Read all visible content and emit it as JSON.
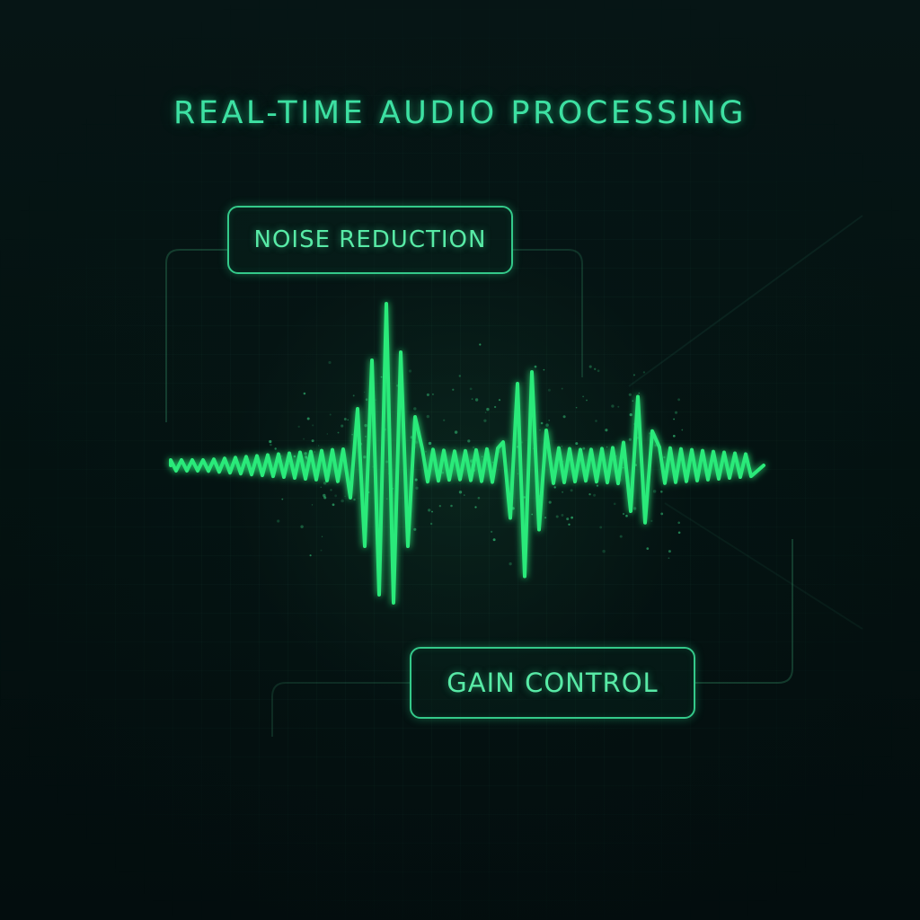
{
  "title": "REAL-TIME AUDIO PROCESSING",
  "labels": {
    "noise_reduction": "NOISE REDUCTION",
    "gain_control": "GAIN CONTROL"
  },
  "colors": {
    "accent": "#3de0a2",
    "wave": "#2bea7a",
    "background": "#041211"
  },
  "waveform": {
    "bursts": [
      {
        "center": 428,
        "amplitude": 180,
        "peaks": [
          -0.1,
          0.2,
          -0.35,
          0.5,
          -0.65,
          0.8,
          -1.0,
          0.85,
          -0.7,
          0.5,
          -0.3
        ]
      },
      {
        "center": 590,
        "amplitude": 130,
        "peaks": [
          -0.2,
          0.45,
          -0.7,
          0.95,
          -0.8,
          0.55,
          -0.3
        ]
      },
      {
        "center": 712,
        "amplitude": 85,
        "peaks": [
          -0.3,
          0.6,
          -0.9,
          0.75,
          -0.45
        ]
      }
    ]
  }
}
